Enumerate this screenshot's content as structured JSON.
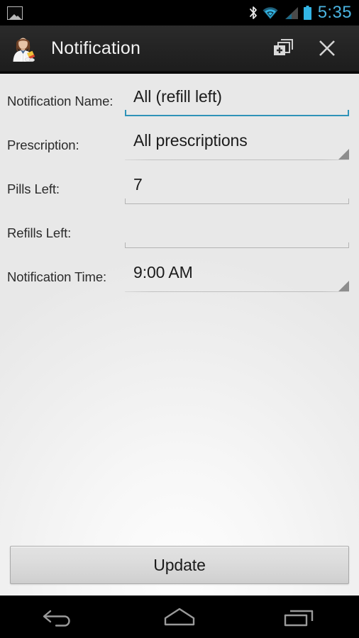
{
  "status_bar": {
    "notification_icon": "photo-icon",
    "time": "5:35",
    "icons": [
      "bluetooth-icon",
      "wifi-icon",
      "cell-signal-icon",
      "battery-icon"
    ],
    "accent_color": "#4ab3e0",
    "background_color": "#000000"
  },
  "action_bar": {
    "app_icon": "pharmacist-app-icon",
    "title": "Notification",
    "actions": [
      {
        "name": "add-new-notification-button",
        "icon": "add-new-icon"
      },
      {
        "name": "close-button",
        "icon": "close-x-icon"
      }
    ],
    "background_color": "#232323",
    "title_color": "#f2f2f2"
  },
  "form": {
    "fields": [
      {
        "label": "Notification Name:",
        "value": "All (refill left)",
        "placeholder": "",
        "type": "text",
        "focused": true,
        "underline_color": "#2f93b8"
      },
      {
        "label": "Prescription:",
        "value": "All prescriptions",
        "placeholder": "",
        "type": "spinner",
        "focused": false,
        "underline_color": "#bdbdbd"
      },
      {
        "label": "Pills Left:",
        "value": "7",
        "placeholder": "",
        "type": "number",
        "focused": false,
        "underline_color": "#b4b4b4"
      },
      {
        "label": "Refills Left:",
        "value": "",
        "placeholder": "",
        "type": "number",
        "focused": false,
        "underline_color": "#b4b4b4"
      },
      {
        "label": "Notification Time:",
        "value": "9:00 AM",
        "placeholder": "",
        "type": "spinner",
        "focused": false,
        "underline_color": "#bdbdbd"
      }
    ]
  },
  "footer": {
    "update_label": "Update"
  },
  "nav_bar": {
    "buttons": [
      {
        "name": "nav-back-button",
        "icon": "back-arrow-icon"
      },
      {
        "name": "nav-home-button",
        "icon": "home-icon"
      },
      {
        "name": "nav-recents-button",
        "icon": "recents-icon"
      }
    ],
    "background_color": "#000000",
    "icon_color": "#9a9a9a"
  }
}
